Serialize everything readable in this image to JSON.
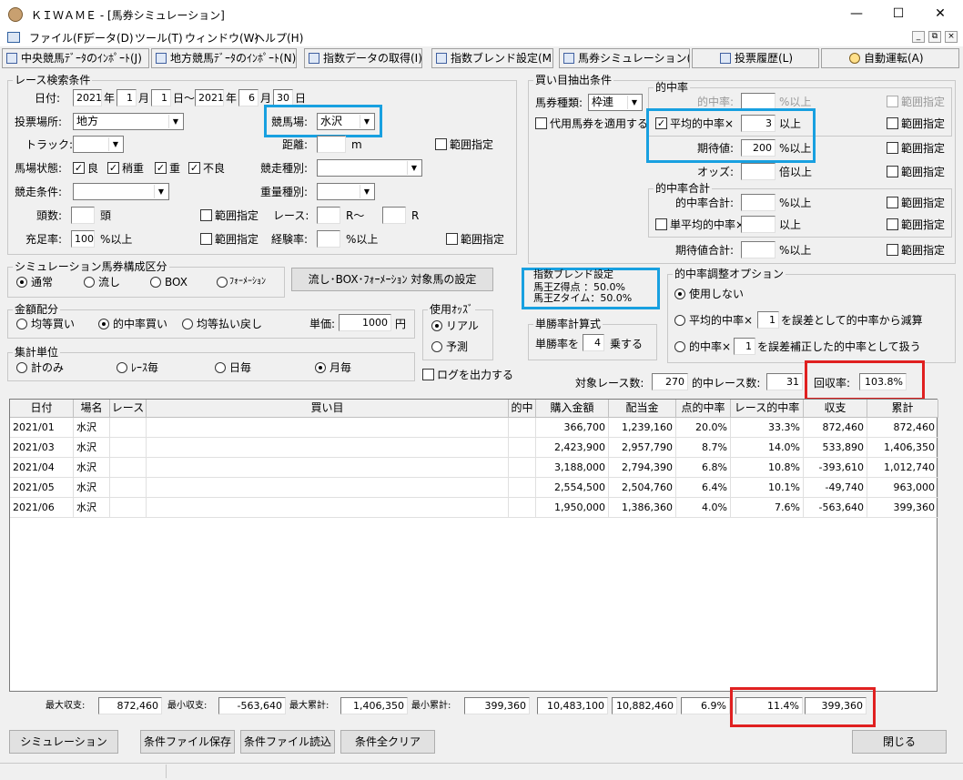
{
  "window": {
    "title": "ＫＩＷＡＭＥ - [馬券シミュレーション]",
    "minimize": "—",
    "maximize": "☐",
    "close": "✕"
  },
  "menu": [
    "ファイル(F)",
    "データ(D)",
    "ツール(T)",
    "ウィンドウ(W)",
    "ヘルプ(H)"
  ],
  "mdi": {
    "min": "_",
    "restore": "⧉",
    "close": "×"
  },
  "toolbar": [
    "中央競馬ﾃﾞｰﾀのｲﾝﾎﾟｰﾄ(J)",
    "地方競馬ﾃﾞｰﾀのｲﾝﾎﾟｰﾄ(N)",
    "指数データの取得(I)",
    "指数ブレンド設定(M)",
    "馬券シミュレーション(B)",
    "投票履歴(L)",
    "自動運転(A)"
  ],
  "race": {
    "group": "レース検索条件",
    "date_label": "日付:",
    "from_year": "2021",
    "year": "年",
    "from_month": "1",
    "month": "月",
    "from_day": "1",
    "day_tilde": "日〜",
    "to_year": "2021",
    "to_month": "6",
    "to_day": "30",
    "day": "日",
    "venue_label": "投票場所:",
    "venue": "地方",
    "track_label": "競馬場:",
    "track": "水沢",
    "trk_label": "トラック:",
    "distance_label": "距離:",
    "distance_unit": "m",
    "range": "範囲指定",
    "cond_label": "馬場状態:",
    "cond": [
      "良",
      "稍重",
      "重",
      "不良"
    ],
    "kind_label": "競走種別:",
    "racecond_label": "競走条件:",
    "weight_label": "重量種別:",
    "heads_label": "頭数:",
    "heads_unit": "頭",
    "race_label": "レース:",
    "race_from": "R〜",
    "race_to": "R",
    "fill_label": "充足率:",
    "fill_value": "100",
    "fill_unit": "%以上",
    "exp_label": "経験率:",
    "exp_unit": "%以上"
  },
  "buy": {
    "group": "買い目抽出条件",
    "type_label": "馬券種類:",
    "type": "枠連",
    "proxy": "代用馬券を適用する",
    "hit_group": "的中率",
    "hit_label": "的中率:",
    "pct_over": "%以上",
    "avg_label": "平均的中率×",
    "avg_value": "3",
    "over": "以上",
    "exp_label": "期待値:",
    "exp_value": "200",
    "odds_label": "オッズ:",
    "odds_unit": "倍以上",
    "total_group": "的中率合計",
    "total_label": "的中率合計:",
    "single_avg": "単平均的中率×",
    "exp_total": "期待値合計:",
    "range": "範囲指定"
  },
  "sim": {
    "group": "シミュレーション馬券構成区分",
    "options": [
      "通常",
      "流し",
      "BOX",
      "ﾌｫｰﾒｰｼｮﾝ"
    ],
    "set_button": "流し･BOX･ﾌｫｰﾒｰｼｮﾝ 対象馬の設定"
  },
  "blend": {
    "group": "指数ブレンド設定",
    "line1": "馬王Z得点 ：50.0%",
    "line2": "馬王Zタイム：50.0%"
  },
  "adjust": {
    "group": "的中率調整オプション",
    "opt1": "使用しない",
    "opt2a": "平均的中率×",
    "opt2v": "1",
    "opt2b": "を誤差として的中率から減算",
    "opt3a": "的中率×",
    "opt3v": "1",
    "opt3b": "を誤差補正した的中率として扱う"
  },
  "money": {
    "group": "金額配分",
    "options": [
      "均等買い",
      "的中率買い",
      "均等払い戻し"
    ],
    "unit_label": "単価:",
    "unit_value": "1000",
    "yen": "円"
  },
  "odds": {
    "group": "使用ｵｯｽﾞ",
    "options": [
      "リアル",
      "予測"
    ]
  },
  "single": {
    "group": "単勝率計算式",
    "label": "単勝率を",
    "value": "4",
    "unit": "乗する"
  },
  "agg": {
    "group": "集計単位",
    "options": [
      "計のみ",
      "ﾚｰｽ毎",
      "日毎",
      "月毎"
    ]
  },
  "log": "ログを出力する",
  "summary": {
    "races_label": "対象レース数:",
    "races": "270",
    "hits_label": "的中レース数:",
    "hits": "31",
    "rate_label": "回収率:",
    "rate": "103.8%"
  },
  "table": {
    "headers": [
      "日付",
      "場名",
      "レース",
      "買い目",
      "的中",
      "購入金額",
      "配当金",
      "点的中率",
      "レース的中率",
      "収支",
      "累計"
    ],
    "rows": [
      [
        "2021/01",
        "水沢",
        "",
        "",
        "",
        "366,700",
        "1,239,160",
        "20.0%",
        "33.3%",
        "872,460",
        "872,460"
      ],
      [
        "2021/03",
        "水沢",
        "",
        "",
        "",
        "2,423,900",
        "2,957,790",
        "8.7%",
        "14.0%",
        "533,890",
        "1,406,350"
      ],
      [
        "2021/04",
        "水沢",
        "",
        "",
        "",
        "3,188,000",
        "2,794,390",
        "6.8%",
        "10.8%",
        "-393,610",
        "1,012,740"
      ],
      [
        "2021/05",
        "水沢",
        "",
        "",
        "",
        "2,554,500",
        "2,504,760",
        "6.4%",
        "10.1%",
        "-49,740",
        "963,000"
      ],
      [
        "2021/06",
        "水沢",
        "",
        "",
        "",
        "1,950,000",
        "1,386,360",
        "4.0%",
        "7.6%",
        "-563,640",
        "399,360"
      ]
    ]
  },
  "footer": {
    "max_inc_label": "最大収支:",
    "max_inc": "872,460",
    "min_inc_label": "最小収支:",
    "min_inc": "-563,640",
    "max_cum_label": "最大累計:",
    "max_cum": "1,406,350",
    "min_cum_label": "最小累計:",
    "min_cum": "399,360",
    "buy_total": "10,483,100",
    "pay_total": "10,882,460",
    "point_hit": "6.9%",
    "race_hit": "11.4%",
    "balance": "399,360"
  },
  "buttons": {
    "simulate": "シミュレーション",
    "save": "条件ファイル保存",
    "load": "条件ファイル読込",
    "clear": "条件全クリア",
    "close": "閉じる"
  }
}
